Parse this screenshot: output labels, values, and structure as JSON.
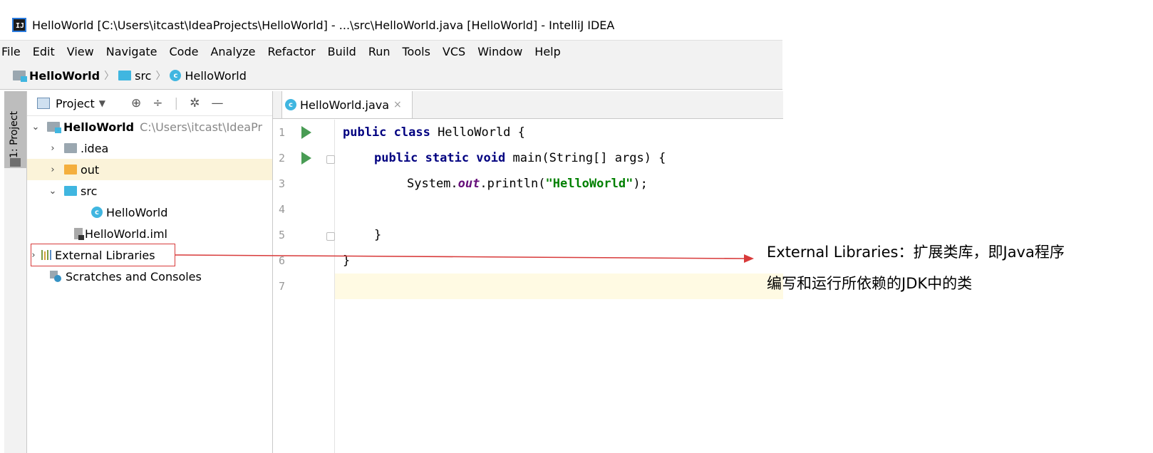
{
  "window": {
    "title": "HelloWorld [C:\\Users\\itcast\\IdeaProjects\\HelloWorld] - ...\\src\\HelloWorld.java [HelloWorld] - IntelliJ IDEA",
    "app_icon_text": "IJ"
  },
  "menubar": {
    "items": [
      "File",
      "Edit",
      "View",
      "Navigate",
      "Code",
      "Analyze",
      "Refactor",
      "Build",
      "Run",
      "Tools",
      "VCS",
      "Window",
      "Help"
    ]
  },
  "breadcrumbs": {
    "items": [
      "HelloWorld",
      "src",
      "HelloWorld"
    ]
  },
  "tool_window_strip": {
    "label": "1: Project"
  },
  "project_panel": {
    "title": "Project",
    "tree": [
      {
        "label": "HelloWorld",
        "path": "C:\\Users\\itcast\\IdeaPr"
      },
      {
        "label": ".idea"
      },
      {
        "label": "out"
      },
      {
        "label": "src"
      },
      {
        "label": "HelloWorld"
      },
      {
        "label": "HelloWorld.iml"
      },
      {
        "label": "External Libraries"
      },
      {
        "label": "Scratches and Consoles"
      }
    ]
  },
  "editor": {
    "tab_label": "HelloWorld.java",
    "line_numbers": [
      "1",
      "2",
      "3",
      "4",
      "5",
      "6",
      "7"
    ],
    "code": {
      "l1_kw": "public class",
      "l1_rest": " HelloWorld {",
      "l2_kw": "public static void",
      "l2_rest": " main(String[] args) {",
      "l3_a": "System.",
      "l3_field": "out",
      "l3_b": ".println(",
      "l3_str": "\"HelloWorld\"",
      "l3_c": ");",
      "l5": "}",
      "l6": "}"
    }
  },
  "annotation": {
    "line1": "External Libraries：扩展类库，即Java程序",
    "line2": "编写和运行所依赖的JDK中的类",
    "color": "#d83a3a"
  }
}
